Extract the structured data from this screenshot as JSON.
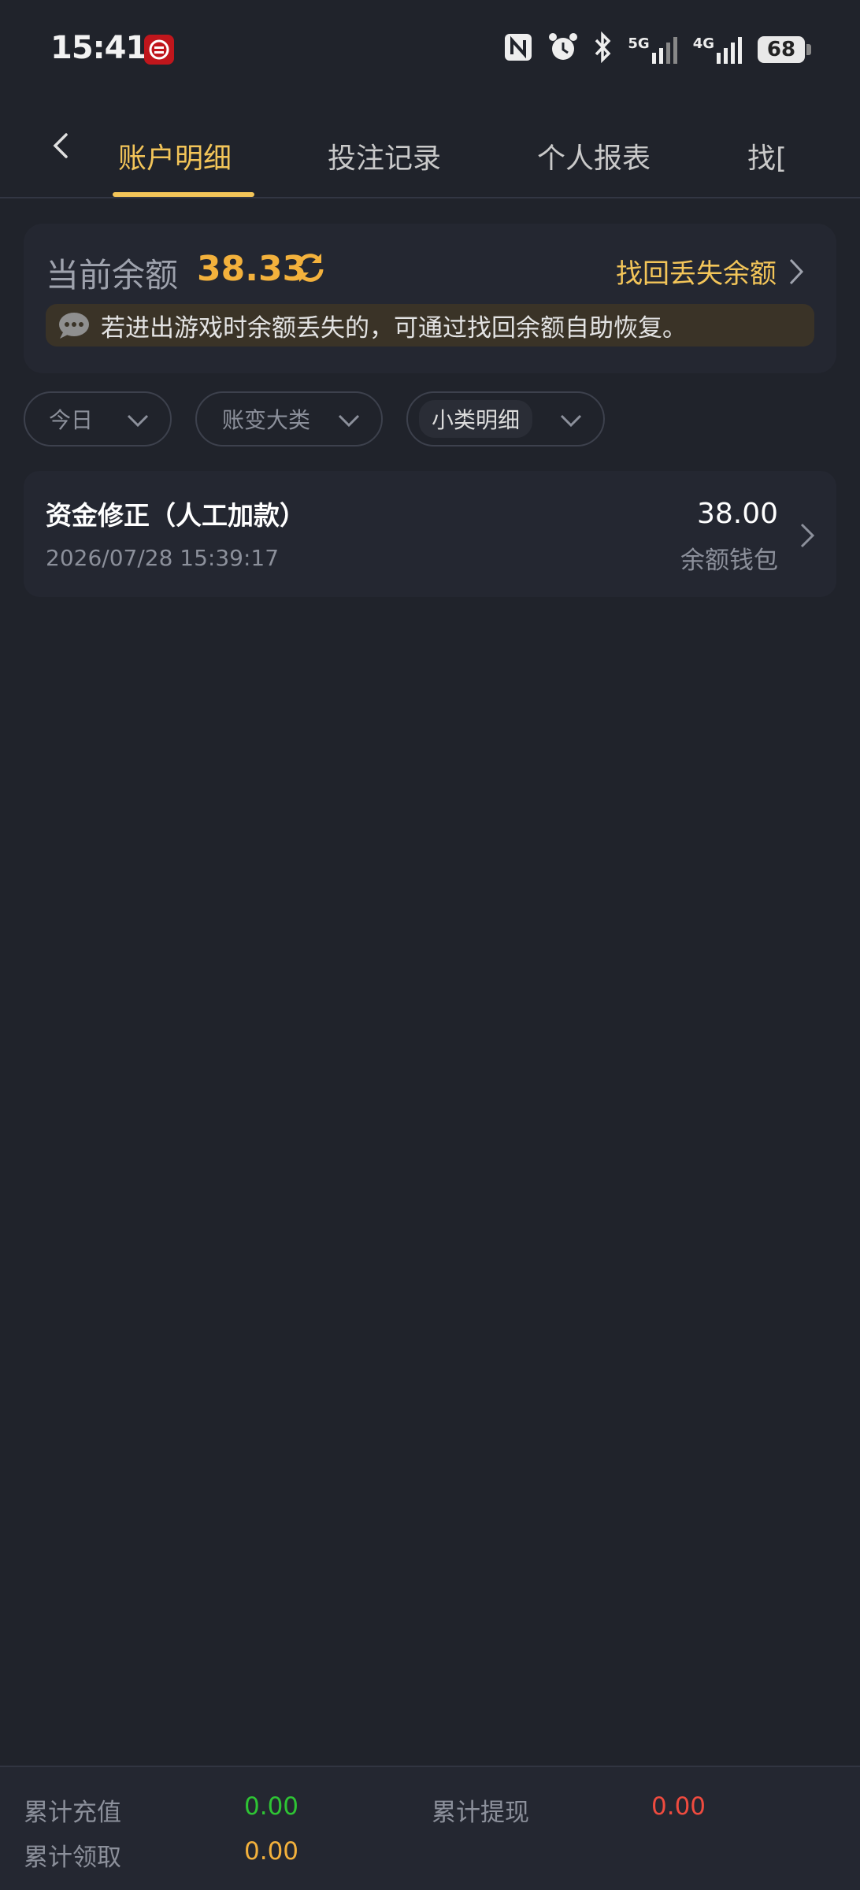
{
  "status_bar": {
    "time": "15:41",
    "network_1": "5G",
    "network_2": "4G",
    "battery": "68",
    "icons": [
      "bank-app-icon",
      "nfc-icon",
      "alarm-icon",
      "bluetooth-icon",
      "signal-5g-icon",
      "signal-4g-icon",
      "battery-icon"
    ]
  },
  "tabs": [
    {
      "label": "账户明细",
      "active": true
    },
    {
      "label": "投注记录",
      "active": false
    },
    {
      "label": "个人报表",
      "active": false
    },
    {
      "label": "找[",
      "active": false
    }
  ],
  "balance": {
    "label": "当前余额",
    "value": "38.33",
    "recover_label": "找回丢失余额",
    "notice": "若进出游戏时余额丢失的，可通过找回余额自助恢复。"
  },
  "filters": [
    {
      "label": "今日"
    },
    {
      "label": "账变大类"
    },
    {
      "label": "小类明细"
    }
  ],
  "records": [
    {
      "title": "资金修正（人工加款）",
      "time": "2026/07/28 15:39:17",
      "amount": "38.00",
      "wallet": "余额钱包"
    }
  ],
  "footer": {
    "recharge_label": "累计充值",
    "recharge_value": "0.00",
    "withdraw_label": "累计提现",
    "withdraw_value": "0.00",
    "claim_label": "累计领取",
    "claim_value": "0.00"
  },
  "colors": {
    "background": "#20232b",
    "accent": "#f3c559",
    "balance": "#f3b13c",
    "recharge": "#2ec434",
    "withdraw": "#ef4b3f",
    "claim": "#f3b13c"
  }
}
